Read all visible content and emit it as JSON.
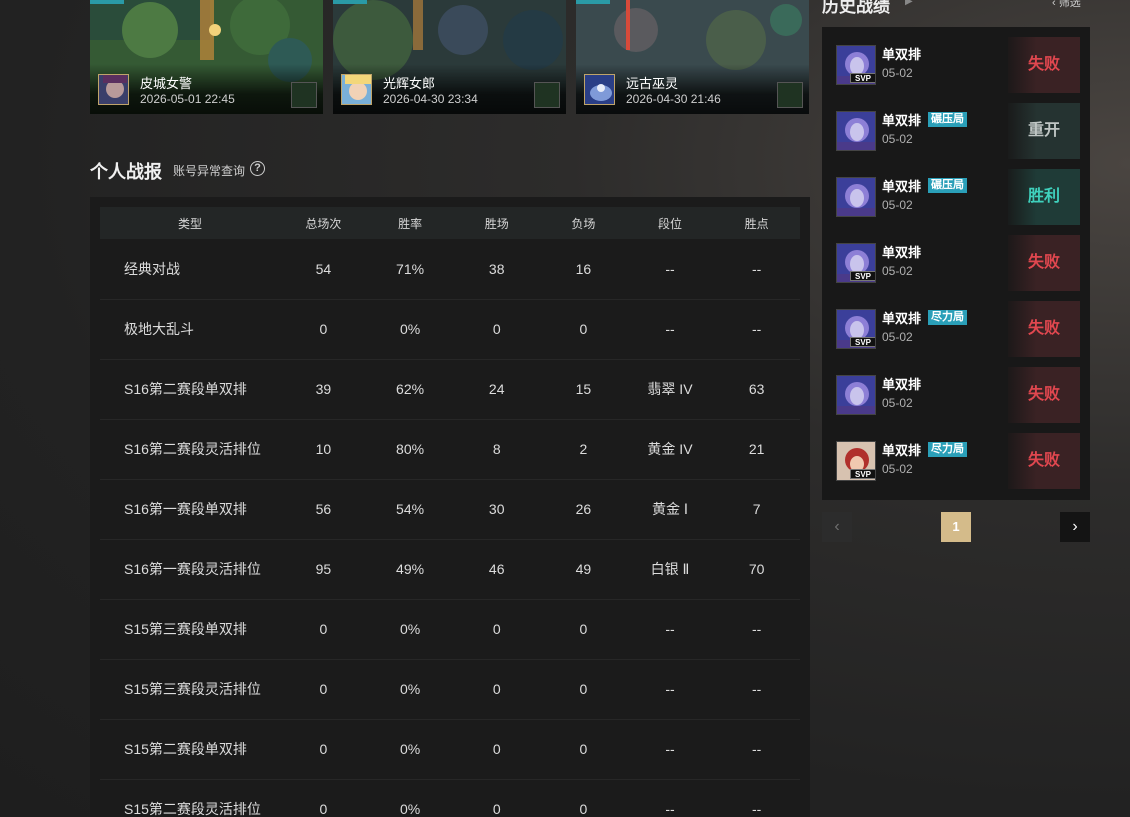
{
  "highlights": [
    {
      "champion": "皮城女警",
      "time": "2026-05-01 22:45"
    },
    {
      "champion": "光辉女郎",
      "time": "2026-04-30 23:34"
    },
    {
      "champion": "远古巫灵",
      "time": "2026-04-30 21:46"
    }
  ],
  "stats_section": {
    "title": "个人战报",
    "link": "账号异常查询",
    "help_glyph": "?"
  },
  "stats_table": {
    "headers": [
      "类型",
      "总场次",
      "胜率",
      "胜场",
      "负场",
      "段位",
      "胜点"
    ],
    "rows": [
      [
        "经典对战",
        "54",
        "71%",
        "38",
        "16",
        "--",
        "--"
      ],
      [
        "极地大乱斗",
        "0",
        "0%",
        "0",
        "0",
        "--",
        "--"
      ],
      [
        "S16第二赛段单双排",
        "39",
        "62%",
        "24",
        "15",
        "翡翠 IV",
        "63"
      ],
      [
        "S16第二赛段灵活排位",
        "10",
        "80%",
        "8",
        "2",
        "黄金 IV",
        "21"
      ],
      [
        "S16第一赛段单双排",
        "56",
        "54%",
        "30",
        "26",
        "黄金 Ⅰ",
        "7"
      ],
      [
        "S16第一赛段灵活排位",
        "95",
        "49%",
        "46",
        "49",
        "白银 Ⅱ",
        "70"
      ],
      [
        "S15第三赛段单双排",
        "0",
        "0%",
        "0",
        "0",
        "--",
        "--"
      ],
      [
        "S15第三赛段灵活排位",
        "0",
        "0%",
        "0",
        "0",
        "--",
        "--"
      ],
      [
        "S15第二赛段单双排",
        "0",
        "0%",
        "0",
        "0",
        "--",
        "--"
      ],
      [
        "S15第二赛段灵活排位",
        "0",
        "0%",
        "0",
        "0",
        "--",
        "--"
      ]
    ]
  },
  "history": {
    "title": "历史战绩",
    "filter": "筛选",
    "matches": [
      {
        "mode": "单双排",
        "badge": "",
        "date": "05-02",
        "result": "失败",
        "result_kind": "lose",
        "svp": "SVP",
        "avatar": "purple"
      },
      {
        "mode": "单双排",
        "badge": "碾压局",
        "date": "05-02",
        "result": "重开",
        "result_kind": "remake",
        "svp": "",
        "avatar": "purple"
      },
      {
        "mode": "单双排",
        "badge": "碾压局",
        "date": "05-02",
        "result": "胜利",
        "result_kind": "win",
        "svp": "",
        "avatar": "purple"
      },
      {
        "mode": "单双排",
        "badge": "",
        "date": "05-02",
        "result": "失败",
        "result_kind": "lose",
        "svp": "SVP",
        "avatar": "purple"
      },
      {
        "mode": "单双排",
        "badge": "尽力局",
        "date": "05-02",
        "result": "失败",
        "result_kind": "lose",
        "svp": "SVP",
        "avatar": "purple"
      },
      {
        "mode": "单双排",
        "badge": "",
        "date": "05-02",
        "result": "失败",
        "result_kind": "lose",
        "svp": "",
        "avatar": "purple"
      },
      {
        "mode": "单双排",
        "badge": "尽力局",
        "date": "05-02",
        "result": "失败",
        "result_kind": "lose",
        "svp": "SVP",
        "avatar": "red"
      }
    ]
  },
  "pagination": {
    "prev": "‹",
    "page": "1",
    "next": "›"
  }
}
